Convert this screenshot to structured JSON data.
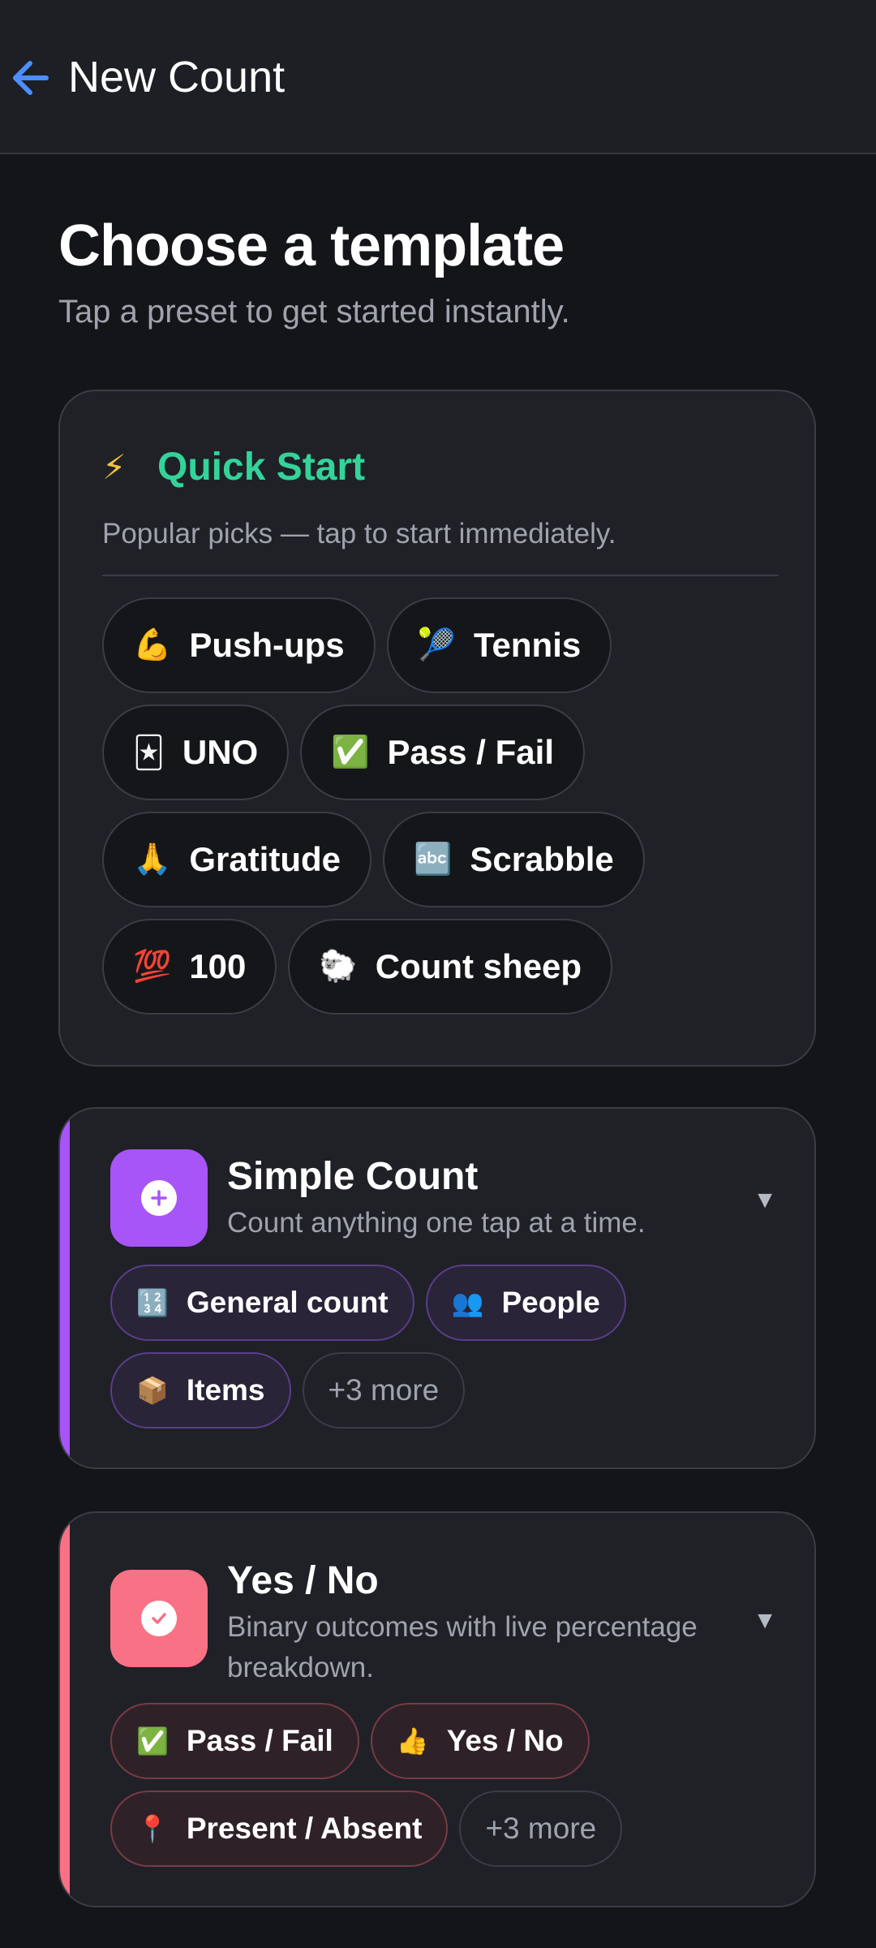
{
  "appbar": {
    "title": "New Count",
    "back_icon": "arrow-left-icon",
    "accent": "#4c8dff"
  },
  "header": {
    "title": "Choose a template",
    "subtitle": "Tap a preset to get started instantly."
  },
  "quick_start": {
    "icon": "⚡",
    "title": "Quick Start",
    "description": "Popular picks — tap to start immediately.",
    "accent": "#34d399",
    "chips": [
      {
        "emoji": "💪",
        "label": "Push-ups"
      },
      {
        "emoji": "🎾",
        "label": "Tennis"
      },
      {
        "emoji": "🃏",
        "label": "UNO"
      },
      {
        "emoji": "✅",
        "label": "Pass / Fail"
      },
      {
        "emoji": "🙏",
        "label": "Gratitude"
      },
      {
        "emoji": "🔤",
        "label": "Scrabble"
      },
      {
        "emoji": "💯",
        "label": "100"
      },
      {
        "emoji": "🐑",
        "label": "Count sheep"
      }
    ]
  },
  "templates": [
    {
      "title": "Simple Count",
      "description": "Count anything one tap at a time.",
      "icon": "plus-icon",
      "color": "#a855f7",
      "chevron": "▼",
      "chips": [
        {
          "emoji": "🔢",
          "label": "General count"
        },
        {
          "emoji": "👥",
          "label": "People"
        },
        {
          "emoji": "📦",
          "label": "Items"
        }
      ],
      "more_label": "+3 more"
    },
    {
      "title": "Yes / No",
      "description": "Binary outcomes with live percentage breakdown.",
      "icon": "check-icon",
      "color": "#f87184",
      "chevron": "▼",
      "chips": [
        {
          "emoji": "✅",
          "label": "Pass / Fail"
        },
        {
          "emoji": "👍",
          "label": "Yes / No"
        },
        {
          "emoji": "📍",
          "label": "Present / Absent"
        }
      ],
      "more_label": "+3 more"
    }
  ]
}
